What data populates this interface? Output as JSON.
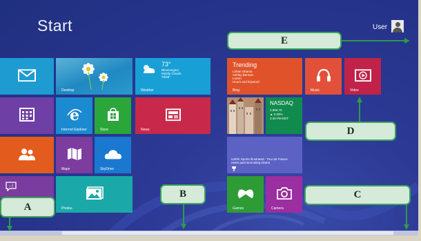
{
  "screen": {
    "title": "Start",
    "user": {
      "name": "User"
    }
  },
  "tiles": {
    "mail": {
      "label": "",
      "icon": "mail-icon",
      "color": "#1e9bd1"
    },
    "desktop": {
      "label": "Desktop",
      "color": "#1f88c2"
    },
    "weather": {
      "label": "Weather",
      "temp": "73°",
      "line1": "Bloomington",
      "line2": "Mostly Clouds",
      "line3": "79/58°",
      "color": "#18a0d6"
    },
    "calendar": {
      "label": "",
      "icon": "calendar-icon",
      "color": "#6e3fa5"
    },
    "ie": {
      "label": "Internet Explorer",
      "icon": "internet-explorer-icon",
      "color": "#1c8ad0"
    },
    "store": {
      "label": "Store",
      "icon": "store-icon",
      "color": "#2aa63a"
    },
    "news": {
      "label": "News",
      "icon": "news-icon",
      "color": "#c8294a"
    },
    "people": {
      "label": "",
      "icon": "people-icon",
      "color": "#e35c1e"
    },
    "maps": {
      "label": "Maps",
      "icon": "maps-icon",
      "color": "#7c3d9f"
    },
    "skydrive": {
      "label": "SkyDrive",
      "icon": "cloud-icon",
      "color": "#1a78d0"
    },
    "messaging": {
      "label": "",
      "icon": "messaging-icon",
      "color": "#7a3c9e"
    },
    "photos": {
      "label": "Photos",
      "icon": "photos-icon",
      "color": "#1aa9a8"
    },
    "bing": {
      "label": "Bing",
      "heading": "Trending",
      "line1": "Lohan Obama",
      "line2": "Ashley Benson",
      "line3": "Lorem",
      "line4": "Hours and keyword",
      "color": "#e0532a"
    },
    "music": {
      "label": "Music",
      "icon": "headphones-icon",
      "color": "#e2503a"
    },
    "video": {
      "label": "Video",
      "icon": "video-icon",
      "color": "#c0224a"
    },
    "travel": {
      "label": "",
      "color": "#a77a5e"
    },
    "finance": {
      "label": "",
      "heading": "NASDAQ",
      "line1": "2,980.70",
      "line2": "▲ 0.29%",
      "line3": "3:45 PM EDT",
      "color": "#118a4e"
    },
    "sports": {
      "label": "",
      "line1": "USRK Sports Illustrated - Tour de France",
      "line2": "nears past Bonzaiing drama",
      "icon": "trophy-icon",
      "color": "#5c62c4"
    },
    "games": {
      "label": "Games",
      "icon": "xbox-icon",
      "color": "#2e9c35"
    },
    "camera": {
      "label": "Camera",
      "icon": "camera-icon",
      "color": "#9b2ea0"
    }
  },
  "callouts": {
    "a": "A",
    "b": "B",
    "c": "C",
    "d": "D",
    "e": "E"
  },
  "colors": {
    "background": "#25338a",
    "callout_fill": "#d5ead8",
    "callout_border": "#3aa35a",
    "arrow": "#2f9a4c"
  }
}
